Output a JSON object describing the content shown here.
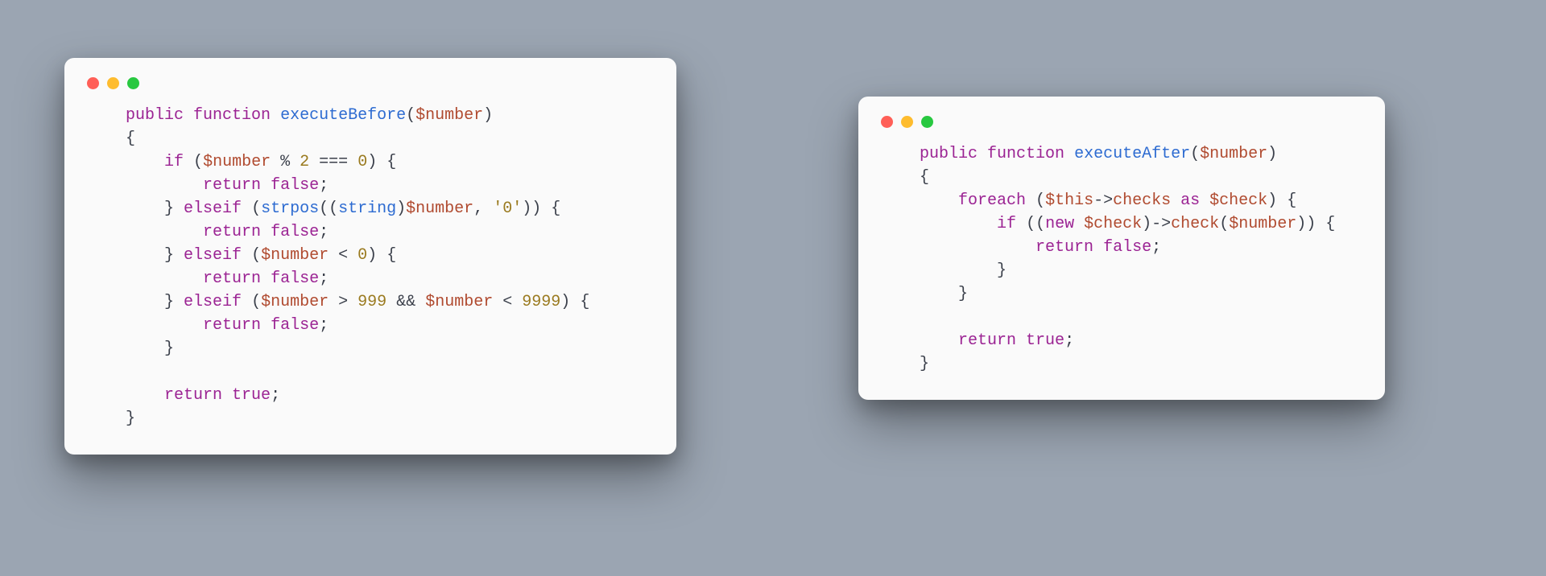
{
  "colors": {
    "background": "#9ba5b2",
    "window_bg": "#fafafa",
    "traffic_red": "#ff5f57",
    "traffic_yellow": "#febc2e",
    "traffic_green": "#28c840",
    "kw": "#9b2393",
    "fn": "#2d6bd1",
    "var": "#b04a2f",
    "num": "#9a7a1f",
    "default": "#3a3f4a"
  },
  "left": {
    "tokens": {
      "kw_public": "public",
      "kw_function": "function",
      "fn_name": "executeBefore",
      "lparen": "(",
      "var_number": "$number",
      "rparen": ")",
      "lbrace": "{",
      "kw_if": "if",
      "op_mod": "%",
      "num_2": "2",
      "op_ident": "===",
      "num_0": "0",
      "rparen2": ")",
      "lbrace2": "{",
      "kw_return": "return",
      "bool_false": "false",
      "semi": ";",
      "rbrace": "}",
      "kw_elseif": "elseif",
      "fn_strpos": "strpos",
      "cast_string": "string",
      "str_zero": "'0'",
      "op_lt": "<",
      "op_gt": ">",
      "num_999": "999",
      "op_and": "&&",
      "num_9999": "9999",
      "bool_true": "true"
    }
  },
  "right": {
    "tokens": {
      "kw_public": "public",
      "kw_function": "function",
      "fn_name": "executeAfter",
      "lparen": "(",
      "var_number": "$number",
      "rparen": ")",
      "lbrace": "{",
      "kw_foreach": "foreach",
      "var_this": "$this",
      "arrow": "->",
      "prop_checks": "checks",
      "kw_as": "as",
      "var_check": "$check",
      "kw_if": "if",
      "kw_new": "new",
      "prop_check": "check",
      "kw_return": "return",
      "bool_false": "false",
      "bool_true": "true",
      "semi": ";",
      "rbrace": "}"
    }
  }
}
